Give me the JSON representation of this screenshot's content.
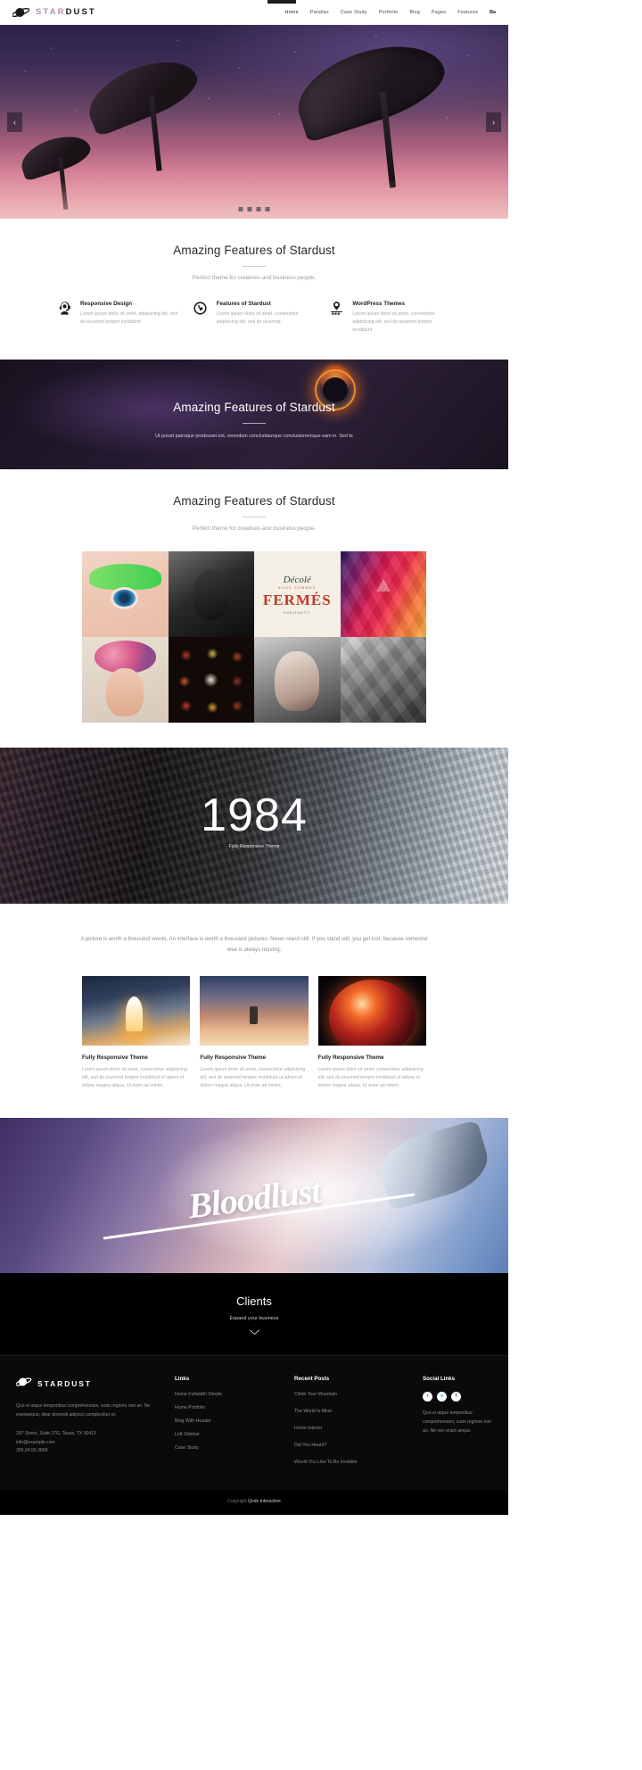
{
  "header": {
    "brand": {
      "part1": "STAR",
      "part2": "DUST",
      "logo_icon": "planet-icon"
    },
    "nav": [
      {
        "label": "Home",
        "active": true
      },
      {
        "label": "Parallax",
        "active": false
      },
      {
        "label": "Case Study",
        "active": false
      },
      {
        "label": "Portfolio",
        "active": false
      },
      {
        "label": "Blog",
        "active": false
      },
      {
        "label": "Pages",
        "active": false
      },
      {
        "label": "Features",
        "active": false
      }
    ],
    "cart_label": "Ba"
  },
  "hero": {
    "prev_label": "‹",
    "next_label": "›",
    "slides": 4,
    "active_slide": 1
  },
  "features_section": {
    "title": "Amazing Features of Stardust",
    "subtitle": "Perfect theme for creatives and business people.",
    "items": [
      {
        "icon": "support-agent-icon",
        "title": "Responsive Design",
        "text": "Lorem ipsum dolor sit amet, adipisicing elit, sed do eiusmod tempor incididunt"
      },
      {
        "icon": "globe-icon",
        "title": "Features of Stardust",
        "text": "Lorem ipsum dolor sit amet, consectetur adipisicing elit, sed do eiusmod"
      },
      {
        "icon": "map-pin-icon",
        "title": "WordPress Themes",
        "text": "Lorem ipsum dolor sit amet, consectetur adipisicing elit, sed do eiusmod tempor incididunt"
      }
    ]
  },
  "parallax_section": {
    "title": "Amazing Features of Stardust",
    "body": "Ut possit patroque prodesset est, vivendum concludaturque conclusionemque eam in. Sed te"
  },
  "portfolio_section": {
    "title": "Amazing Features of Stardust",
    "subtitle": "Perfect theme for creatives and business people.",
    "tiles": [
      {
        "name": "green-eye-makeup"
      },
      {
        "name": "black-paint-portrait"
      },
      {
        "name": "fermes-poster"
      },
      {
        "name": "geometric-gradient"
      },
      {
        "name": "flower-crown-portrait"
      },
      {
        "name": "food-bowls-grid"
      },
      {
        "name": "beauty-portrait"
      },
      {
        "name": "low-poly-deer"
      }
    ],
    "poster": {
      "line1": "Décolé",
      "line2": "NOUS SOMMES",
      "line3": "FERMÉS",
      "line4": "EMBLEMATIC"
    }
  },
  "year_section": {
    "number": "1984",
    "caption": "Fully Responsive Theme"
  },
  "quote_section": {
    "text": "A picture is worth a thousand words. An interface is worth a thousand pictures. Never stand still. If you stand still, you get lost, because someone else is always moving."
  },
  "blog_section": {
    "cards": [
      {
        "image": "rocket-launch-image",
        "title": "Fully Responsive Theme",
        "text": "Lorem ipsum dolor sit amet, consectetur adipisicing elit, sed do eiusmod tempor incididunt ut labore et dolore magna aliqua. Ut enim ad minim."
      },
      {
        "image": "astronaut-desert-image",
        "title": "Fully Responsive Theme",
        "text": "Lorem ipsum dolor sit amet, consectetur adipisicing elit, sed do eiusmod tempor incididunt ut labore et dolore magna aliqua. Ut enim ad minim."
      },
      {
        "image": "burning-planet-image",
        "title": "Fully Responsive Theme",
        "text": "Lorem ipsum dolor sit amet, consectetur adipisicing elit, sed do eiusmod tempor incididunt ut labore et dolore magna aliqua. Ut enim ad minim."
      }
    ]
  },
  "bloodlust_section": {
    "script_text": "Bloodlust",
    "image": "rocket-launch-clouds-image"
  },
  "clients_section": {
    "title": "Clients",
    "subtitle": "Expand your business",
    "chevron_icon": "chevron-down-icon"
  },
  "footer": {
    "brand": {
      "part1": "STAR",
      "part2": "DUST",
      "logo_icon": "planet-icon"
    },
    "about": "Quo ei atque temporibus comprehensam, iusto regione mei an. Ne erantaeque, dear docendi adipisci complectitur ei.",
    "address": "257 Street, Suite 27G, Texas, TX 30413",
    "email": "info@example.com",
    "phone": "356.24.55.3699",
    "links": {
      "title": "Links",
      "items": [
        "Home Fullwidth Simple",
        "Home Portfolio",
        "Blog With Header",
        "Left Sidebar",
        "Case Study"
      ]
    },
    "recent_posts": {
      "title": "Recent Posts",
      "items": [
        "Climb Your Mountain",
        "The World Is Mine",
        "Home Interior",
        "Did You Heard?",
        "Would You Like To Be Invisible"
      ]
    },
    "social": {
      "title": "Social Links",
      "icons": [
        {
          "name": "twitter-icon",
          "glyph": "t"
        },
        {
          "name": "vimeo-icon",
          "glyph": "v"
        },
        {
          "name": "facebook-icon",
          "glyph": "f"
        }
      ],
      "text": "Quo ei atque temporibus comprehensam, iusto regione mei an. Ne nec erant aeque."
    },
    "copyright_prefix": "Copyright ",
    "copyright_brand": "Qode Interactive"
  },
  "colors": {
    "accent": "#b98fb0",
    "dark": "#0a0a0a",
    "muted": "#a6a6a6"
  }
}
